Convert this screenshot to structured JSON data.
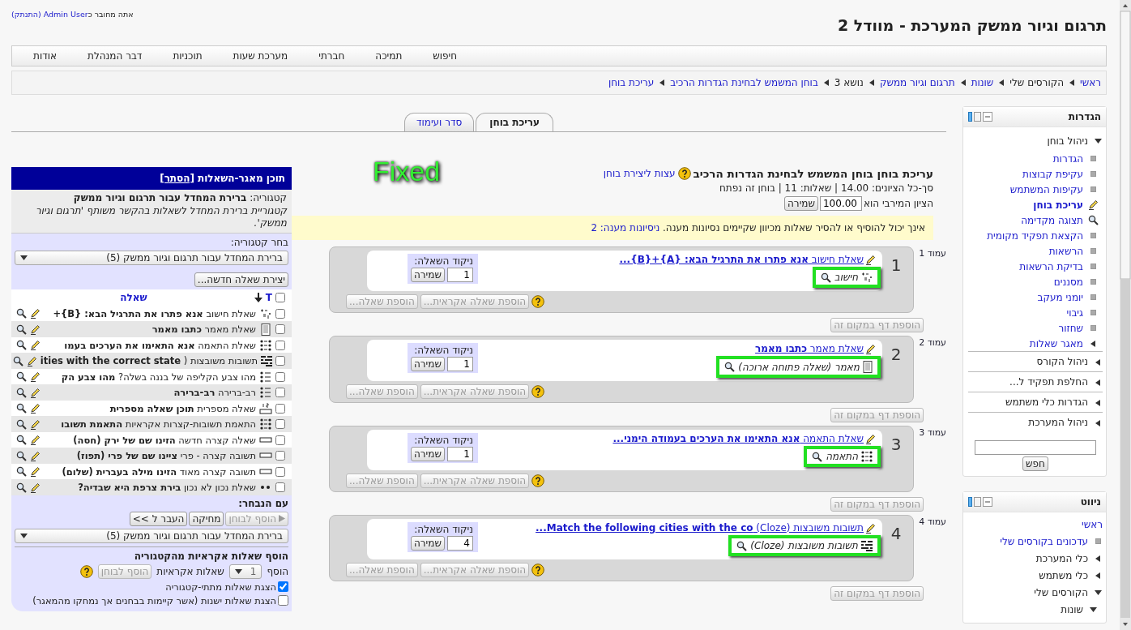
{
  "header": {
    "title": "תרגום וגיור ממשק המערכת - מוודל 2",
    "login": {
      "prefix": "אתה מחובר כ",
      "user": "Admin User",
      "logout": "(התנתק)"
    }
  },
  "menu": [
    "חיפוש",
    "תמיכה",
    "חברתי",
    "מערכת שעות",
    "תוכניות",
    "דבר המנהלת",
    "אודות"
  ],
  "breadcrumb": [
    {
      "label": "ראשי",
      "link": true
    },
    {
      "label": "הקורסים שלי",
      "link": false
    },
    {
      "label": "שונות",
      "link": true
    },
    {
      "label": "תרגום וגיור ממשק",
      "link": true
    },
    {
      "label": "נושא 3",
      "link": false
    },
    {
      "label": "בוחן המשמש לבחינת הגדרות הרכיב",
      "link": true
    },
    {
      "label": "עריכת בוחן",
      "link": true
    }
  ],
  "tabs": [
    {
      "label": "עריכת בוחן",
      "selected": true
    },
    {
      "label": "סדר ועימוד",
      "selected": false
    }
  ],
  "quiz": {
    "heading": "עריכת בוחן בוחן המשמש לבחינת הגדרות הרכיב",
    "tips_link": "עצות ליצירת בוחן",
    "summary": "סך-כל הציונים: 14.00 | שאלות: 11 | בוחן זה נפתח",
    "max_grade_label": "הציון המירבי הוא",
    "max_grade": "100.00",
    "save": "שמירה",
    "notice": "אינך יכול להוסיף או להסיר שאלות מכיוון שקיימים נסיונות מענה.",
    "attempts_link": "ניסיונות מענה: 2",
    "annotation": "Fixed"
  },
  "pages": [
    {
      "label": "עמוד 1",
      "number": "1",
      "question": "שאלת חישוב **אנא פתרו את התרגיל הבא: {A}+{B}...**",
      "type": "חישוב",
      "kind": "calc",
      "mark_label": "ניקוד השאלה:",
      "mark": "1",
      "save": "שמירה",
      "buttons_disabled": true,
      "add_random": "הוספת שאלה אקראית...",
      "add_question": "הוספת שאלה...",
      "add_page": "הוספת דף במקום זה"
    },
    {
      "label": "עמוד 2",
      "number": "2",
      "question": "שאלת מאמר **כתבו מאמר**",
      "type": "מאמר (שאלה פתוחה ארוכה)",
      "kind": "essay",
      "mark_label": "ניקוד השאלה:",
      "mark": "1",
      "save": "שמירה",
      "buttons_disabled": true,
      "add_random": "הוספת שאלה אקראית...",
      "add_question": "הוספת שאלה...",
      "add_page": "הוספת דף במקום זה"
    },
    {
      "label": "עמוד 3",
      "number": "3",
      "question": "שאלת התאמה **אנא התאימו את הערכים בעמודה הימני...**",
      "type": "התאמה",
      "kind": "match",
      "mark_label": "ניקוד השאלה:",
      "mark": "1",
      "save": "שמירה",
      "buttons_disabled": true,
      "add_random": "הוספת שאלה אקראית...",
      "add_question": "הוספת שאלה...",
      "add_page": "הוספת דף במקום זה"
    },
    {
      "label": "עמוד 4",
      "number": "4",
      "question": "תשובות משובצות (Cloze) **Match the following cities with the co...**",
      "type": "תשובות משובצות (Cloze)",
      "kind": "cloze",
      "mark_label": "ניקוד השאלה:",
      "mark": "4",
      "save": "שמירה",
      "buttons_disabled": true,
      "add_random": "הוספת שאלה אקראית...",
      "add_question": "הוספת שאלה...",
      "add_page": "הוספת דף במקום זה"
    }
  ],
  "bank": {
    "title": "תוכן מאגר-השאלות",
    "hide_link": "[הסתר]",
    "category_label": "קטגוריה:",
    "category_name": "ברירת המחדל עבור תרגום וגיור ממשק",
    "category_info": "קטגוריית ברירת המחדל לשאלות בהקשר משותף 'תרגום וגיור ממשק'.",
    "choose_label": "בחר קטגוריה:",
    "category_select": "ברירת המחדל עבור תרגום וגיור ממשק (5)",
    "new_question": "יצירת שאלה חדשה...",
    "select_all_checked": false,
    "type_column": "T",
    "question_column": "שאלה",
    "questions": [
      {
        "kind": "calc",
        "text": "שאלת חישוב **אנא פתרו את התרגיל הבא: {B}+**",
        "checked": false
      },
      {
        "kind": "essay",
        "text": "שאלת מאמר **כתבו מאמר**",
        "checked": false
      },
      {
        "kind": "match",
        "text": "שאלת התאמה **אנא התאימו את הערכים בעמו**",
        "checked": false
      },
      {
        "kind": "cloze",
        "text": "תשובות משובצות ( **ities with the correct state**",
        "checked": false
      },
      {
        "kind": "multichoice",
        "text": "מהו צבע הקליפה של בננה בשלה? **מהו צבע הק**",
        "checked": false
      },
      {
        "kind": "multichoice",
        "text": "רב-ברירה **רב-ברירה**",
        "checked": false
      },
      {
        "kind": "numerical",
        "text": "שאלה מספרית **תוכן שאלה מספרית**",
        "checked": false
      },
      {
        "kind": "randommatch",
        "text": "התאמת תשובות-קצרות אקראיות **התאמת תשובו**",
        "checked": false
      },
      {
        "kind": "shortanswer",
        "text": "שאלה קצרה חדשה **הזינו שם של ירק (חסה)**",
        "checked": false
      },
      {
        "kind": "shortanswer",
        "text": "תשובה קצרה - פרי **ציינו שם של פרי (תפוז)**",
        "checked": false
      },
      {
        "kind": "shortanswer",
        "text": "תשובה קצרה מאוד **הזינו מילה בעברית (שלום)**",
        "checked": false
      },
      {
        "kind": "truefalse",
        "text": "שאלת נכון לא נכון **בירת צרפת היא שבדיה?**",
        "checked": false
      }
    ],
    "with_selected": "עם הנבחר:",
    "add_to_quiz": {
      "label": "הוסף לבוחן",
      "disabled": true
    },
    "delete": "מחיקה",
    "move_to": "העבר ל >>",
    "move_select": "ברירת המחדל עבור תרגום וגיור ממשק (5)",
    "random_title": "הוסף שאלות אקראיות מהקטגוריה",
    "random_add": "הוסף",
    "random_count": "1",
    "random_suffix": "שאלות אקראיות",
    "random_button": {
      "label": "הוסף לבוחן",
      "disabled": true
    },
    "options": [
      {
        "label": "הצגת שאלות מתתי-קטגוריה",
        "checked": true
      },
      {
        "label": "הצגת שאלות ישנות (אשר קיימות בבחנים אך נמחקו מהמאגר)",
        "checked": false
      }
    ]
  },
  "settings_block": {
    "title": "הגדרות",
    "search_button": "חפש",
    "items": [
      {
        "label": "ניהול בוחן",
        "kind": "branch",
        "expanded": true,
        "linked": false,
        "children": [
          {
            "label": "הגדרות",
            "kind": "leaf"
          },
          {
            "label": "עקיפת קבוצות",
            "kind": "leaf"
          },
          {
            "label": "עקיפות המשתמש",
            "kind": "leaf"
          },
          {
            "label": "עריכת בוחן",
            "kind": "current"
          },
          {
            "label": "תצוגה מקדימה",
            "kind": "preview"
          },
          {
            "label": "הקצאת תפקיד מקומית",
            "kind": "leaf"
          },
          {
            "label": "הרשאות",
            "kind": "leaf"
          },
          {
            "label": "בדיקת הרשאות",
            "kind": "leaf"
          },
          {
            "label": "מסננים",
            "kind": "leaf"
          },
          {
            "label": "יומני מעקב",
            "kind": "leaf"
          },
          {
            "label": "גיבוי",
            "kind": "leaf"
          },
          {
            "label": "שחזור",
            "kind": "leaf"
          },
          {
            "label": "מאגר שאלות",
            "kind": "branch",
            "expanded": false,
            "linked": true
          }
        ]
      },
      {
        "label": "ניהול הקורס",
        "kind": "branch",
        "expanded": false,
        "linked": false
      },
      {
        "label": "החלפת תפקיד ל...",
        "kind": "branch",
        "expanded": false,
        "linked": false
      },
      {
        "label": "הגדרות כלי משתמש",
        "kind": "branch",
        "expanded": false,
        "linked": false
      },
      {
        "label": "ניהול המערכת",
        "kind": "branch",
        "expanded": false,
        "linked": false
      }
    ]
  },
  "navigation_block": {
    "title": "ניווט",
    "items": [
      {
        "label": "ראשי",
        "kind": "home"
      },
      {
        "label": "עדכונים בקורסים שלי",
        "kind": "leaf"
      },
      {
        "label": "כלי המערכת",
        "kind": "branch",
        "expanded": false,
        "linked": false
      },
      {
        "label": "כלי משתמש",
        "kind": "branch",
        "expanded": false,
        "linked": false
      },
      {
        "label": "הקורסים שלי",
        "kind": "branch",
        "expanded": true,
        "linked": false,
        "children": [
          {
            "label": "שונות",
            "kind": "branch",
            "expanded": true,
            "linked": false
          }
        ]
      }
    ]
  }
}
